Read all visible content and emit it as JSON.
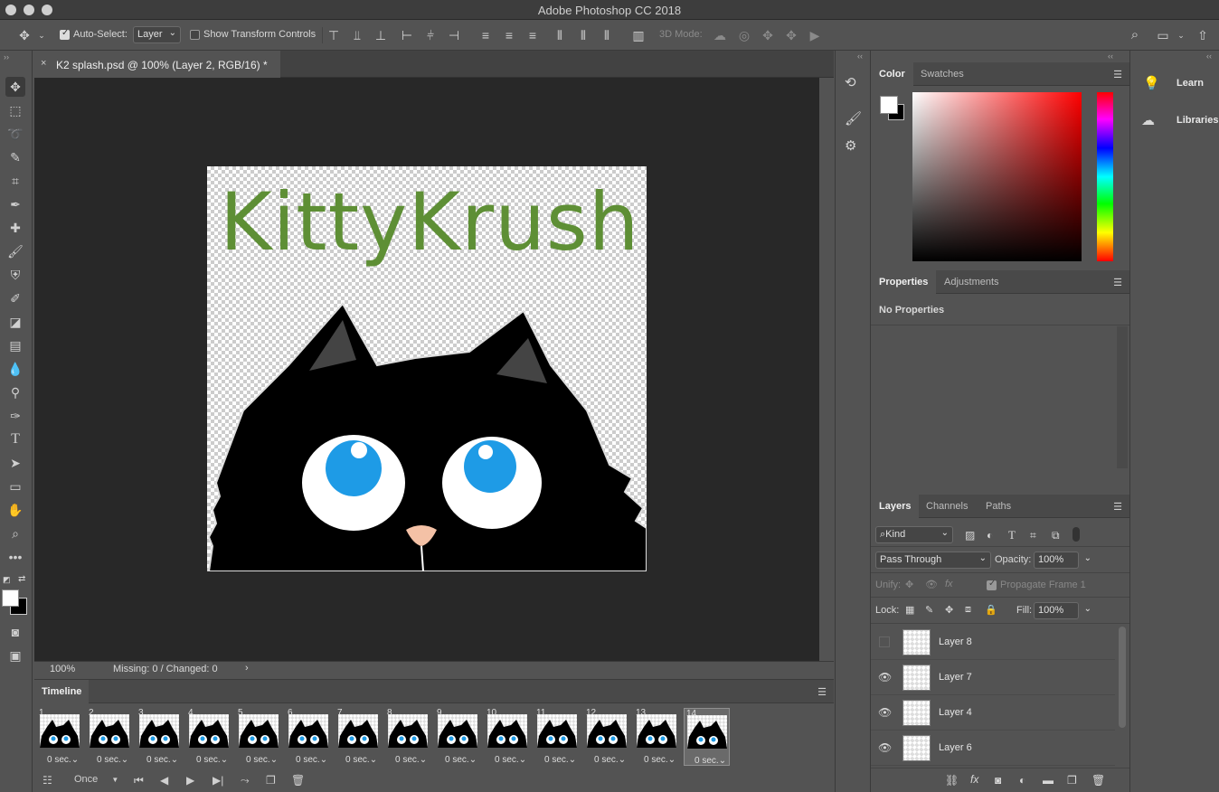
{
  "app": {
    "title": "Adobe Photoshop CC 2018"
  },
  "options_bar": {
    "auto_select_label": "Auto-Select:",
    "auto_select_checked": true,
    "auto_select_value": "Layer",
    "show_transform_label": "Show Transform Controls",
    "show_transform_checked": false,
    "mode_3d_label": "3D Mode:"
  },
  "document": {
    "tab_title": "K2 splash.psd @ 100% (Layer 2, RGB/16) *",
    "logo_text": "KittyKrush",
    "logo_color": "#5e8f35"
  },
  "status_bar": {
    "zoom": "100%",
    "info": "Missing: 0 / Changed: 0"
  },
  "timeline": {
    "title": "Timeline",
    "frames": [
      {
        "num": "1",
        "duration": "0 sec."
      },
      {
        "num": "2",
        "duration": "0 sec."
      },
      {
        "num": "3",
        "duration": "0 sec."
      },
      {
        "num": "4",
        "duration": "0 sec."
      },
      {
        "num": "5",
        "duration": "0 sec."
      },
      {
        "num": "6",
        "duration": "0 sec."
      },
      {
        "num": "7",
        "duration": "0 sec."
      },
      {
        "num": "8",
        "duration": "0 sec."
      },
      {
        "num": "9",
        "duration": "0 sec."
      },
      {
        "num": "10",
        "duration": "0 sec."
      },
      {
        "num": "11",
        "duration": "0 sec."
      },
      {
        "num": "12",
        "duration": "0 sec."
      },
      {
        "num": "13",
        "duration": "0 sec."
      },
      {
        "num": "14",
        "duration": "0 sec."
      }
    ],
    "selected_frame": "14",
    "loop_value": "Once"
  },
  "color_panel": {
    "tabs": [
      "Color",
      "Swatches"
    ],
    "active": "Color"
  },
  "properties_panel": {
    "tabs": [
      "Properties",
      "Adjustments"
    ],
    "active": "Properties",
    "empty_text": "No Properties"
  },
  "layers_panel": {
    "tabs": [
      "Layers",
      "Channels",
      "Paths"
    ],
    "active": "Layers",
    "filter_value": "Kind",
    "blend_mode": "Pass Through",
    "opacity_label": "Opacity:",
    "opacity_value": "100%",
    "unify_label": "Unify:",
    "propagate_label": "Propagate Frame 1",
    "lock_label": "Lock:",
    "fill_label": "Fill:",
    "fill_value": "100%",
    "layers": [
      {
        "name": "Layer 8",
        "visible": false
      },
      {
        "name": "Layer 7",
        "visible": true
      },
      {
        "name": "Layer 4",
        "visible": true
      },
      {
        "name": "Layer 6",
        "visible": true
      }
    ]
  },
  "learn_panel": {
    "items": [
      {
        "label": "Learn",
        "icon": "lightbulb-icon"
      },
      {
        "label": "Libraries",
        "icon": "cc-libraries-icon"
      }
    ]
  }
}
